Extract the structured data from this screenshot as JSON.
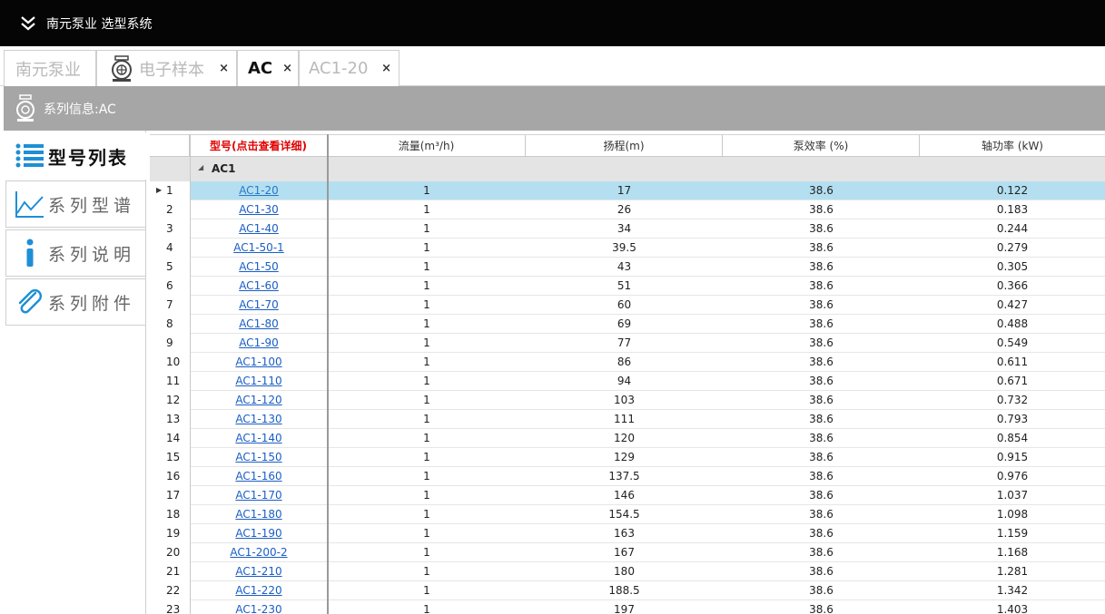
{
  "titlebar": {
    "title": "南元泵业 选型系统",
    "collapse_icon": "double-chevron-down-icon"
  },
  "tabs": [
    {
      "label": "南元泵业",
      "closable": false,
      "active": false
    },
    {
      "label": "电子样本",
      "closable": true,
      "active": false,
      "icon": "pump-icon"
    },
    {
      "label": "AC",
      "closable": true,
      "active": true
    },
    {
      "label": "AC1-20",
      "closable": true,
      "active": false
    }
  ],
  "close_glyph": "×",
  "series": {
    "label": "系列信息:AC",
    "icon": "pump-icon"
  },
  "nav": [
    {
      "label": "型号列表",
      "icon": "list-icon",
      "active": true
    },
    {
      "label": "系列型谱",
      "icon": "chart-line-icon",
      "active": false
    },
    {
      "label": "系列说明",
      "icon": "info-icon",
      "active": false
    },
    {
      "label": "系列附件",
      "icon": "paperclip-icon",
      "active": false
    }
  ],
  "table": {
    "headers": [
      "型号(点击查看详细)",
      "流量(m³/h)",
      "扬程(m)",
      "泵效率 (%)",
      "轴功率 (kW)"
    ],
    "group": "AC1",
    "rows": [
      {
        "n": "1",
        "model": "AC1-20",
        "flow": "1",
        "head": "17",
        "eff": "38.6",
        "power": "0.122",
        "selected": true
      },
      {
        "n": "2",
        "model": "AC1-30",
        "flow": "1",
        "head": "26",
        "eff": "38.6",
        "power": "0.183"
      },
      {
        "n": "3",
        "model": "AC1-40",
        "flow": "1",
        "head": "34",
        "eff": "38.6",
        "power": "0.244"
      },
      {
        "n": "4",
        "model": "AC1-50-1",
        "flow": "1",
        "head": "39.5",
        "eff": "38.6",
        "power": "0.279"
      },
      {
        "n": "5",
        "model": "AC1-50",
        "flow": "1",
        "head": "43",
        "eff": "38.6",
        "power": "0.305"
      },
      {
        "n": "6",
        "model": "AC1-60",
        "flow": "1",
        "head": "51",
        "eff": "38.6",
        "power": "0.366"
      },
      {
        "n": "7",
        "model": "AC1-70",
        "flow": "1",
        "head": "60",
        "eff": "38.6",
        "power": "0.427"
      },
      {
        "n": "8",
        "model": "AC1-80",
        "flow": "1",
        "head": "69",
        "eff": "38.6",
        "power": "0.488"
      },
      {
        "n": "9",
        "model": "AC1-90",
        "flow": "1",
        "head": "77",
        "eff": "38.6",
        "power": "0.549"
      },
      {
        "n": "10",
        "model": "AC1-100",
        "flow": "1",
        "head": "86",
        "eff": "38.6",
        "power": "0.611"
      },
      {
        "n": "11",
        "model": "AC1-110",
        "flow": "1",
        "head": "94",
        "eff": "38.6",
        "power": "0.671"
      },
      {
        "n": "12",
        "model": "AC1-120",
        "flow": "1",
        "head": "103",
        "eff": "38.6",
        "power": "0.732"
      },
      {
        "n": "13",
        "model": "AC1-130",
        "flow": "1",
        "head": "111",
        "eff": "38.6",
        "power": "0.793"
      },
      {
        "n": "14",
        "model": "AC1-140",
        "flow": "1",
        "head": "120",
        "eff": "38.6",
        "power": "0.854"
      },
      {
        "n": "15",
        "model": "AC1-150",
        "flow": "1",
        "head": "129",
        "eff": "38.6",
        "power": "0.915"
      },
      {
        "n": "16",
        "model": "AC1-160",
        "flow": "1",
        "head": "137.5",
        "eff": "38.6",
        "power": "0.976"
      },
      {
        "n": "17",
        "model": "AC1-170",
        "flow": "1",
        "head": "146",
        "eff": "38.6",
        "power": "1.037"
      },
      {
        "n": "18",
        "model": "AC1-180",
        "flow": "1",
        "head": "154.5",
        "eff": "38.6",
        "power": "1.098"
      },
      {
        "n": "19",
        "model": "AC1-190",
        "flow": "1",
        "head": "163",
        "eff": "38.6",
        "power": "1.159"
      },
      {
        "n": "20",
        "model": "AC1-200-2",
        "flow": "1",
        "head": "167",
        "eff": "38.6",
        "power": "1.168"
      },
      {
        "n": "21",
        "model": "AC1-210",
        "flow": "1",
        "head": "180",
        "eff": "38.6",
        "power": "1.281"
      },
      {
        "n": "22",
        "model": "AC1-220",
        "flow": "1",
        "head": "188.5",
        "eff": "38.6",
        "power": "1.342"
      },
      {
        "n": "23",
        "model": "AC1-230",
        "flow": "1",
        "head": "197",
        "eff": "38.6",
        "power": "1.403"
      }
    ]
  },
  "colors": {
    "titlebar": "#050505",
    "series_bar": "#a6a6a6",
    "selected_row": "#b3dff0",
    "link": "#1a5ec4",
    "header_model": "#e00000",
    "accent_blue": "#1e8fd5"
  }
}
